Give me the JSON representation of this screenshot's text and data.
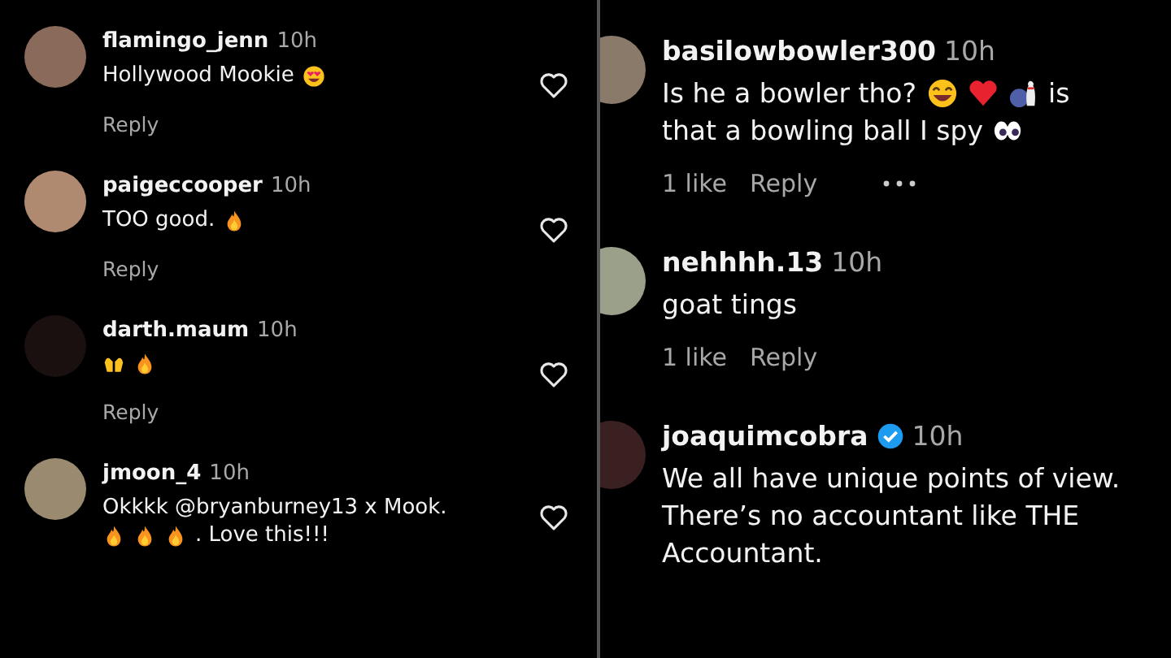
{
  "left_comments": [
    {
      "user": "flamingo_jenn",
      "time": "10h",
      "lines": [
        [
          {
            "kind": "text",
            "text": "Hollywood Mookie"
          },
          {
            "kind": "heart_eyes"
          }
        ]
      ],
      "reply": "Reply"
    },
    {
      "user": "paigeccooper",
      "time": "10h",
      "lines": [
        [
          {
            "kind": "text",
            "text": "TOO good."
          },
          {
            "kind": "fire"
          }
        ]
      ],
      "reply": "Reply"
    },
    {
      "user": "darth.maum",
      "time": "10h",
      "lines": [
        [
          {
            "kind": "raised_hands"
          },
          {
            "kind": "fire"
          }
        ]
      ],
      "reply": "Reply"
    },
    {
      "user": "jmoon_4",
      "time": "10h",
      "lines": [
        [
          {
            "kind": "text",
            "text": "Okkkk @bryanburney13 x Mook."
          }
        ],
        [
          {
            "kind": "fire"
          },
          {
            "kind": "fire"
          },
          {
            "kind": "fire"
          },
          {
            "kind": "text",
            "text": ". Love this!!!"
          }
        ]
      ]
    }
  ],
  "right_comments": [
    {
      "user": "basilowbowler300",
      "time": "10h",
      "lines": [
        [
          {
            "kind": "text",
            "text": "Is he a bowler tho?"
          },
          {
            "kind": "laughing"
          },
          {
            "kind": "red_heart"
          },
          {
            "kind": "bowling"
          },
          {
            "kind": "text",
            "text": "is"
          }
        ],
        [
          {
            "kind": "text",
            "text": "that a bowling ball I spy"
          },
          {
            "kind": "eyes"
          }
        ]
      ],
      "likes": "1 like",
      "reply": "Reply",
      "more": true
    },
    {
      "user": "nehhhh.13",
      "time": "10h",
      "lines": [
        [
          {
            "kind": "text",
            "text": "goat tings"
          }
        ]
      ],
      "likes": "1 like",
      "reply": "Reply"
    },
    {
      "user": "joaquimcobra",
      "time": "10h",
      "verified": true,
      "lines": [
        [
          {
            "kind": "text",
            "text": "We all have unique points of view."
          }
        ],
        [
          {
            "kind": "text",
            "text": "There’s no accountant like THE"
          }
        ],
        [
          {
            "kind": "text",
            "text": "Accountant."
          }
        ]
      ]
    }
  ]
}
